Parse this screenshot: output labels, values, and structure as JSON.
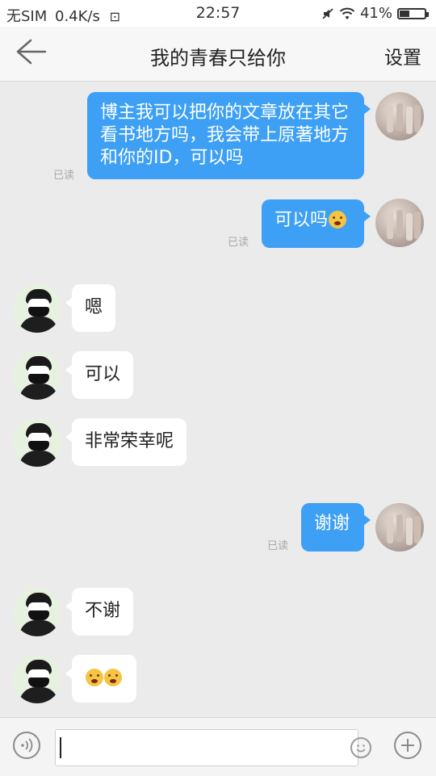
{
  "status_bar": {
    "carrier": "无SIM",
    "net_speed": "0.4K/s",
    "time": "22:57",
    "battery": "41%",
    "battery_level": 0.41
  },
  "header": {
    "back_icon": "arrow-left-icon",
    "title": "我的青春只给你",
    "settings_label": "设置"
  },
  "messages": [
    {
      "side": "out",
      "text": "博主我可以把你的文章放在其它看书地方吗，我会带上原著地方和你的ID，可以吗",
      "read": "已读"
    },
    {
      "side": "out",
      "text": "可以吗",
      "emoji": "grimace-face",
      "read": "已读"
    },
    {
      "side": "in",
      "text": "嗯"
    },
    {
      "side": "in",
      "text": "可以"
    },
    {
      "side": "in",
      "text": "非常荣幸呢"
    },
    {
      "side": "out",
      "text": "谢谢",
      "read": "已读"
    },
    {
      "side": "in",
      "text": "不谢"
    },
    {
      "side": "in",
      "text": "",
      "emoji": "scared-face-x2"
    }
  ],
  "input_bar": {
    "voice_icon": "voice-icon",
    "placeholder": "",
    "emoji_icon": "smiley-icon",
    "plus_icon": "plus-icon"
  }
}
